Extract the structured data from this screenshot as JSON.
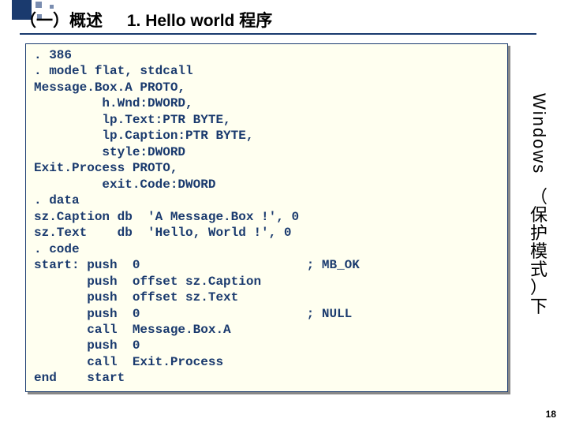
{
  "title": {
    "section": "（一）概述",
    "heading": "1. Hello world 程序"
  },
  "code": ". 386\n. model flat, stdcall\nMessage.Box.A PROTO,\n         h.Wnd:DWORD,\n         lp.Text:PTR BYTE,\n         lp.Caption:PTR BYTE,\n         style:DWORD\nExit.Process PROTO,\n         exit.Code:DWORD\n. data\nsz.Caption db  'A Message.Box !', 0\nsz.Text    db  'Hello, World !', 0\n. code\nstart: push  0                      ; MB_OK\n       push  offset sz.Caption\n       push  offset sz.Text\n       push  0                      ; NULL\n       call  Message.Box.A\n       push  0\n       call  Exit.Process\nend    start",
  "side": {
    "eng": "Windows",
    "cjk_lines": [
      "（",
      "保",
      "护",
      "模",
      "式",
      "）",
      "下"
    ]
  },
  "page_number": "18"
}
